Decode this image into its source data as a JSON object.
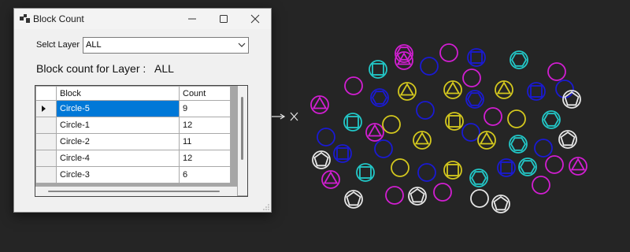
{
  "window": {
    "title": "Block Count",
    "icons": {
      "app": "app-window-icon",
      "minimize": "minimize-icon",
      "maximize": "maximize-icon",
      "close": "close-icon"
    }
  },
  "layer_select": {
    "label": "Selct Layer",
    "value": "ALL",
    "icon": "chevron-down-icon"
  },
  "summary": {
    "label": "Block count for Layer :",
    "value": "ALL"
  },
  "grid": {
    "columns": [
      "Block",
      "Count"
    ],
    "rows": [
      {
        "block": "Circle-5",
        "count": "9",
        "selected": true
      },
      {
        "block": "Circle-1",
        "count": "12",
        "selected": false
      },
      {
        "block": "Circle-2",
        "count": "11",
        "selected": false
      },
      {
        "block": "Circle-4",
        "count": "12",
        "selected": false
      },
      {
        "block": "Circle-3",
        "count": "6",
        "selected": false
      }
    ]
  },
  "canvas": {
    "background": "#252525",
    "cursor_icon": "crosshair-cursor-icon",
    "colors": {
      "magenta": "#d21ed2",
      "blue": "#1a1ad2",
      "cyan": "#22c8c8",
      "yellow": "#d4c81e",
      "white": "#e6e6e6"
    }
  }
}
